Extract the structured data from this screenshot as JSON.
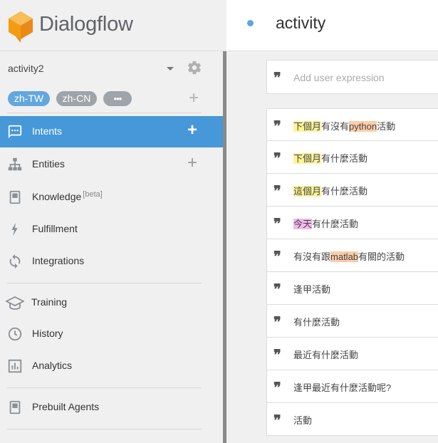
{
  "app": {
    "name": "Dialogflow"
  },
  "agent": {
    "name": "activity2"
  },
  "languages": [
    {
      "code": "zh-TW",
      "active": true
    },
    {
      "code": "zh-CN",
      "active": false
    },
    {
      "code": "•••",
      "active": false
    }
  ],
  "nav": {
    "intents": "Intents",
    "entities": "Entities",
    "knowledge": "Knowledge",
    "knowledge_badge": "[beta]",
    "fulfillment": "Fulfillment",
    "integrations": "Integrations",
    "training": "Training",
    "history": "History",
    "analytics": "Analytics",
    "prebuilt": "Prebuilt Agents"
  },
  "intent": {
    "title": "activity"
  },
  "expression_input": {
    "placeholder": "Add user expression"
  },
  "phrases": [
    {
      "segments": [
        {
          "text": "下個月",
          "hl": "yellow"
        },
        {
          "text": "有沒有",
          "hl": ""
        },
        {
          "text": "python",
          "hl": "orange"
        },
        {
          "text": "活動",
          "hl": ""
        }
      ]
    },
    {
      "segments": [
        {
          "text": "下個月",
          "hl": "yellow"
        },
        {
          "text": "有什麼活動",
          "hl": ""
        }
      ]
    },
    {
      "segments": [
        {
          "text": "這個月",
          "hl": "yellow"
        },
        {
          "text": "有什麼活動",
          "hl": ""
        }
      ]
    },
    {
      "segments": [
        {
          "text": "今天",
          "hl": "pink"
        },
        {
          "text": "有什麼活動",
          "hl": ""
        }
      ]
    },
    {
      "segments": [
        {
          "text": "有沒有跟",
          "hl": ""
        },
        {
          "text": "matlab",
          "hl": "orange"
        },
        {
          "text": "有關的活動",
          "hl": ""
        }
      ]
    },
    {
      "segments": [
        {
          "text": "逢甲活動",
          "hl": ""
        }
      ]
    },
    {
      "segments": [
        {
          "text": "有什麼活動",
          "hl": ""
        }
      ]
    },
    {
      "segments": [
        {
          "text": "最近有什麼活動",
          "hl": ""
        }
      ]
    },
    {
      "segments": [
        {
          "text": "逢甲最近有什麼活動呢?",
          "hl": ""
        }
      ]
    },
    {
      "segments": [
        {
          "text": "活動",
          "hl": ""
        }
      ]
    }
  ],
  "colors": {
    "accent": "#4698d9",
    "chip_active": "#64a7de",
    "chip_inactive": "#9ea4aa",
    "logo_orange": "#f5a623",
    "highlight_yellow": "#fdf498",
    "highlight_orange": "#fbcda9",
    "highlight_pink": "#f4b8ec"
  }
}
